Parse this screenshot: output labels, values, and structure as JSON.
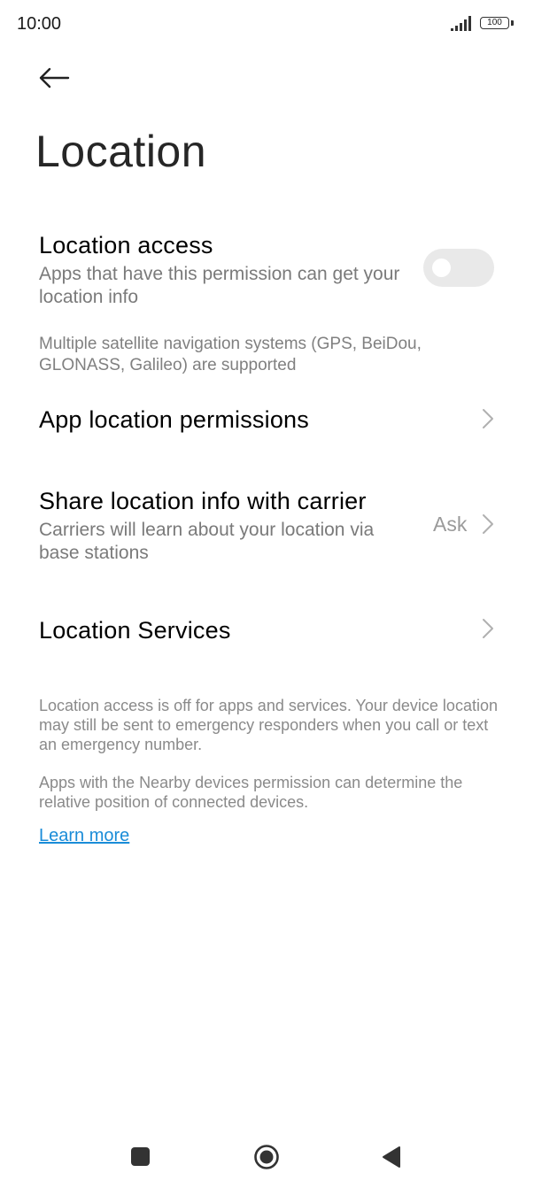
{
  "status_bar": {
    "time": "10:00",
    "battery": "100"
  },
  "header": {
    "title": "Location"
  },
  "location_access": {
    "title": "Location access",
    "subtitle": "Apps that have this permission can get your location info",
    "enabled": false
  },
  "gnss_note": "Multiple satellite navigation systems (GPS, BeiDou, GLONASS, Galileo) are supported",
  "app_permissions": {
    "title": "App location permissions"
  },
  "carrier": {
    "title": "Share location info with carrier",
    "subtitle": "Carriers will learn about your location via base stations",
    "value": "Ask"
  },
  "services": {
    "title": "Location Services"
  },
  "footer": {
    "emergency_note": "Location access is off for apps and services. Your device location may still be sent to emergency responders when you call or text an emergency number.",
    "nearby_note": "Apps with the Nearby devices permission can determine the relative position of connected devices.",
    "learn_more": "Learn more"
  },
  "colors": {
    "link": "#1a8cd8",
    "toggle_off": "#e9e9e9"
  }
}
